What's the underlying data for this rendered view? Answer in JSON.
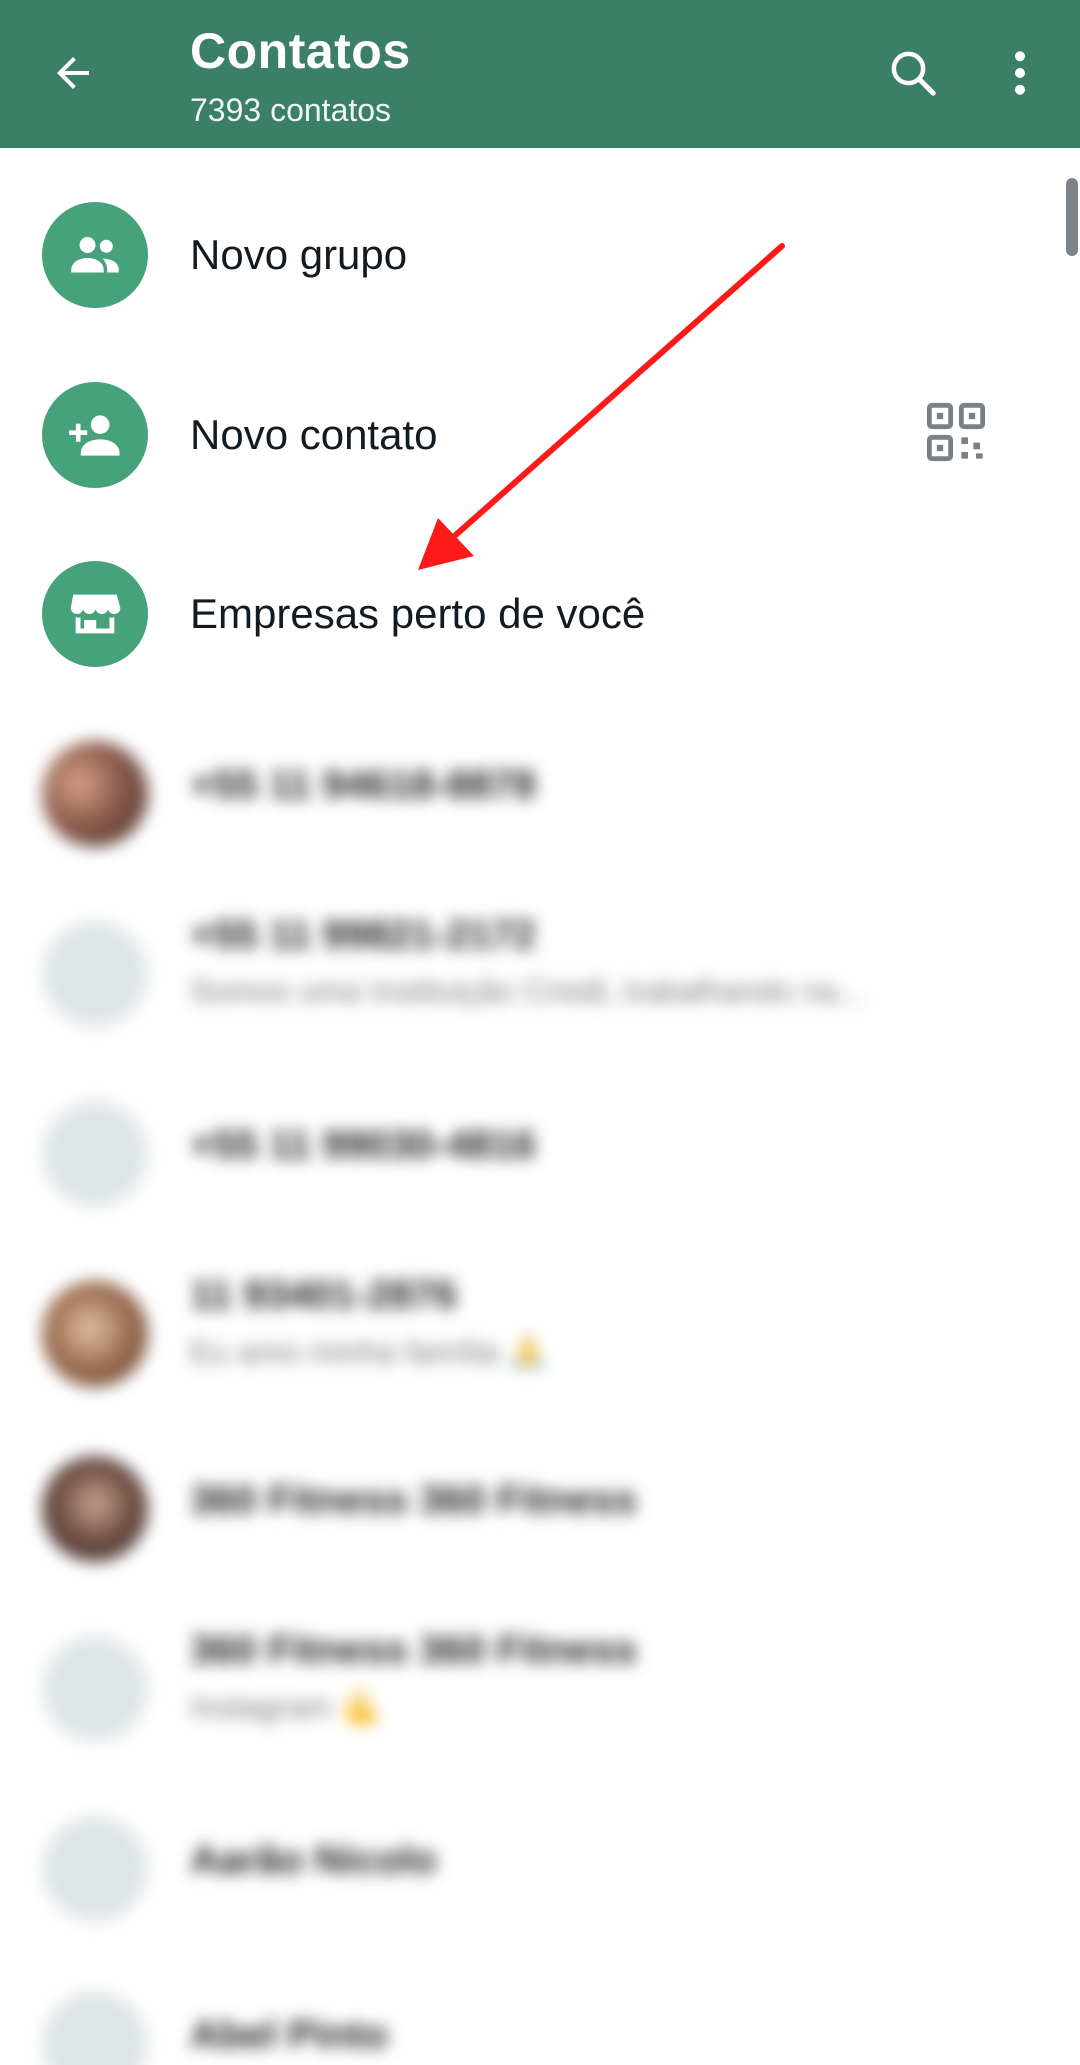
{
  "header": {
    "title": "Contatos",
    "subtitle": "7393 contatos",
    "back_icon": "arrow-left-icon",
    "search_icon": "search-icon",
    "menu_icon": "more-vertical-icon",
    "background": "#3b7f66"
  },
  "actions": [
    {
      "label": "Novo grupo",
      "icon": "group-icon"
    },
    {
      "label": "Novo contato",
      "icon": "add-person-icon",
      "trailing_icon": "qr-code-icon"
    },
    {
      "label": "Empresas perto de você",
      "icon": "store-icon"
    }
  ],
  "contacts": [
    {
      "name": "+55 11 94618-8878",
      "status": ""
    },
    {
      "name": "+55 11 99821-2172",
      "status": "Somos uma Instituição Cristã, trabalhando na..."
    },
    {
      "name": "+55 11 99030-4816",
      "status": ""
    },
    {
      "name": "11 93401-2876",
      "status": "Eu amo minha família 🙏"
    },
    {
      "name": "360 Fitness 360 Fitness",
      "status": ""
    },
    {
      "name": "360 Fitness 360 Fitness",
      "status": "Instagram 💪"
    },
    {
      "name": "Aarão Nicolo",
      "status": ""
    },
    {
      "name": "Abel Pinto",
      "status": ""
    }
  ],
  "colors": {
    "accent": "#45a27a",
    "annotation_arrow": "#ff1a1a"
  }
}
